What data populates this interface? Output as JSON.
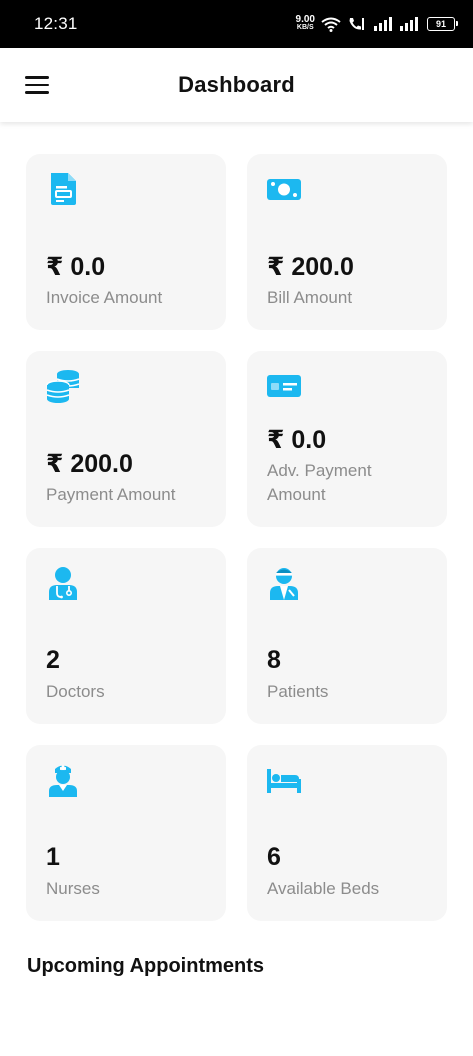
{
  "status_bar": {
    "time": "12:31",
    "net_speed_value": "9.00",
    "net_speed_unit": "KB/S",
    "battery": "91"
  },
  "app_bar": {
    "title": "Dashboard",
    "menu_icon": "hamburger-menu-icon"
  },
  "accent_color": "#1cb8f0",
  "cards": [
    {
      "icon": "invoice-document-icon",
      "value": "₹ 0.0",
      "label": "Invoice Amount"
    },
    {
      "icon": "cash-bill-icon",
      "value": "₹ 200.0",
      "label": "Bill Amount"
    },
    {
      "icon": "coins-stack-icon",
      "value": "₹ 200.0",
      "label": "Payment Amount"
    },
    {
      "icon": "credit-card-icon",
      "value": "₹ 0.0",
      "label": "Adv. Payment Amount"
    },
    {
      "icon": "doctor-icon",
      "value": "2",
      "label": "Doctors"
    },
    {
      "icon": "patient-icon",
      "value": "8",
      "label": "Patients"
    },
    {
      "icon": "nurse-icon",
      "value": "1",
      "label": "Nurses"
    },
    {
      "icon": "bed-icon",
      "value": "6",
      "label": "Available Beds"
    }
  ],
  "upcoming_appointments": {
    "title": "Upcoming Appointments"
  }
}
